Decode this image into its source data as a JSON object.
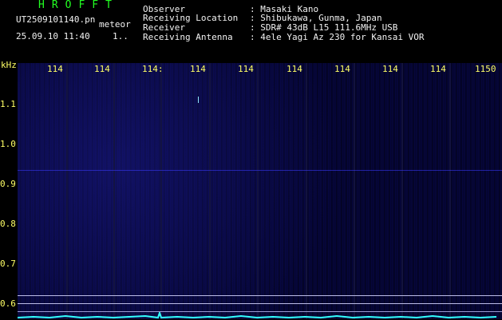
{
  "header": {
    "brand": "HROFFT",
    "filename": "UT2509101140.pn",
    "mode": "meteor",
    "datetime": "25.09.10 11:40",
    "count": "1..",
    "info": [
      {
        "label": "Observer",
        "value": ": Masaki Kano"
      },
      {
        "label": "Receiving Location",
        "value": ": Shibukawa, Gunma, Japan"
      },
      {
        "label": "Receiver",
        "value": ": SDR# 43dB L15 111.6MHz USB"
      },
      {
        "label": "Receiving Antenna",
        "value": ": 4ele Yagi Az 230 for Kansai VOR"
      }
    ]
  },
  "axes": {
    "y_unit": "kHz",
    "x_ticks": [
      "114",
      "114",
      "114:",
      "114",
      "114",
      "114",
      "114",
      "114",
      "114",
      "1150"
    ],
    "y_ticks": [
      "1.1",
      "1.0",
      "0.9",
      "0.8",
      "0.7",
      "0.6"
    ]
  },
  "colors": {
    "text_yellow": "#ffff66",
    "brand_green": "#22ff22",
    "spectrogram_blue": "#06063d",
    "signal_cyan": "#33ffff"
  }
}
